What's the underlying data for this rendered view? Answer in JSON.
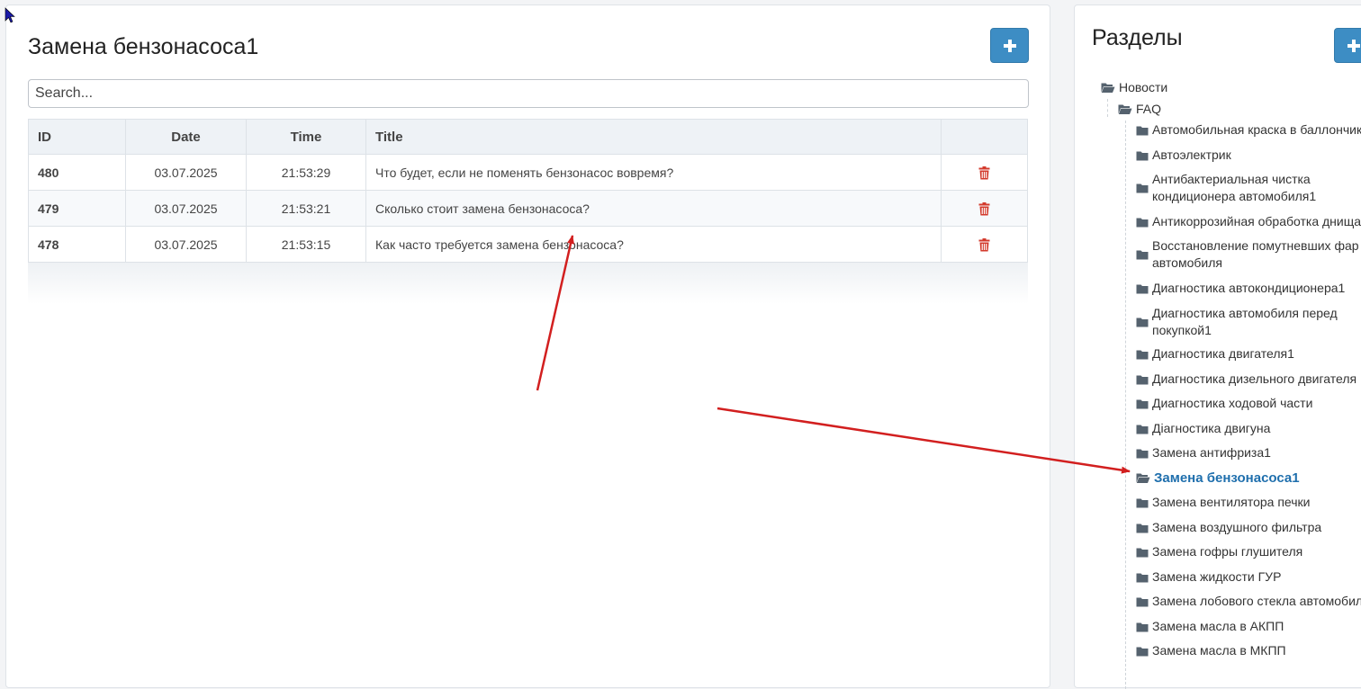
{
  "main": {
    "title": "Замена бензонасоса1",
    "add_button_icon": "plus-icon",
    "search": {
      "placeholder": "Search...",
      "value": ""
    },
    "table": {
      "headers": {
        "id": "ID",
        "date": "Date",
        "time": "Time",
        "title": "Title"
      },
      "rows": [
        {
          "id": "480",
          "date": "03.07.2025",
          "time": "21:53:29",
          "title": "Что будет, если не поменять бензонасос вовремя?"
        },
        {
          "id": "479",
          "date": "03.07.2025",
          "time": "21:53:21",
          "title": "Сколько стоит замена бензонасоса?"
        },
        {
          "id": "478",
          "date": "03.07.2025",
          "time": "21:53:15",
          "title": "Как часто требуется замена бензонасоса?"
        }
      ],
      "delete_icon": "trash-icon"
    }
  },
  "sidebar": {
    "title": "Разделы",
    "add_button_icon": "plus-icon",
    "tree": {
      "root": "Новости",
      "faq": "FAQ",
      "items": [
        "Автомобильная краска в баллончиках",
        "Автоэлектрик",
        "Антибактериальная чистка кондиционера автомобиля1",
        "Антикоррозийная обработка днища1",
        "Восстановление помутневших фар автомобиля",
        "Диагностика автокондиционера1",
        "Диагностика автомобиля перед покупкой1",
        "Диагностика двигателя1",
        "Диагностика дизельного двигателя",
        "Диагностика ходовой части",
        "Діагностика двигуна",
        "Замена антифриза1",
        "Замена бензонасоса1",
        "Замена вентилятора печки",
        "Замена воздушного фильтра",
        "Замена гофры глушителя",
        "Замена жидкости ГУР",
        "Замена лобового стекла автомобиля",
        "Замена масла в АКПП",
        "Замена масла в МКПП"
      ],
      "active_index": 12
    }
  },
  "colors": {
    "accent": "#3d8dc4",
    "active_link": "#1f6fad",
    "delete": "#d33a2c",
    "annotation_arrow": "#d21f1f"
  }
}
